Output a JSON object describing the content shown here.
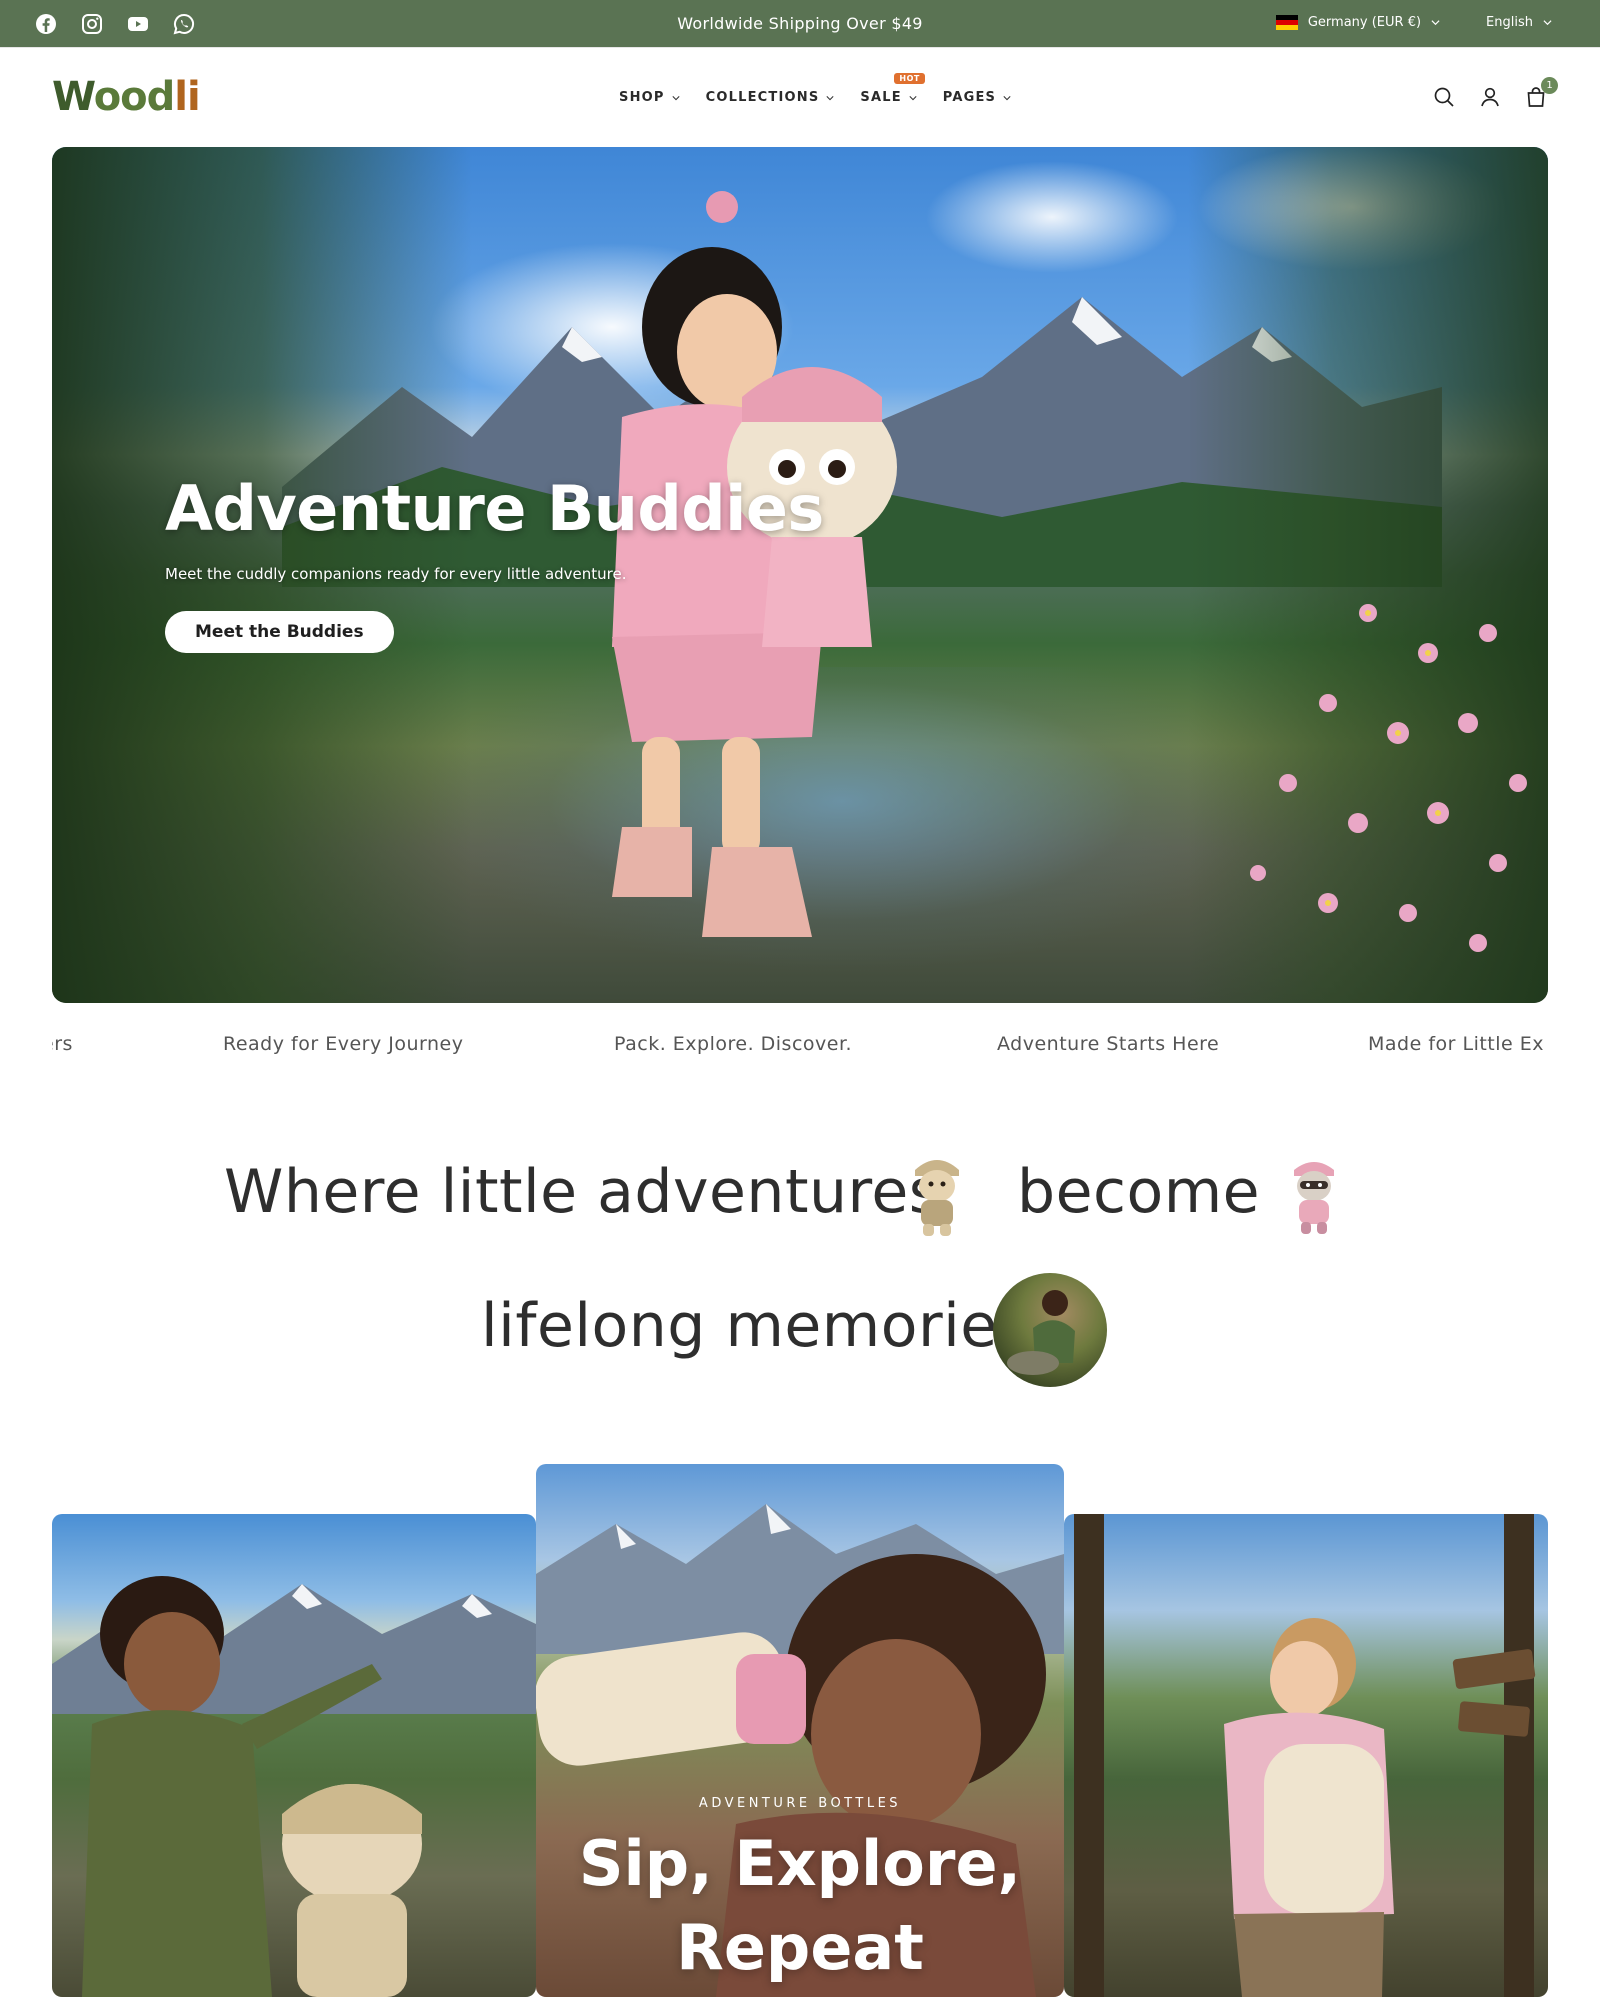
{
  "topbar": {
    "announcement": "Worldwide Shipping Over $49",
    "social": [
      "facebook-icon",
      "instagram-icon",
      "youtube-icon",
      "whatsapp-icon"
    ],
    "currency": "Germany (EUR €)",
    "language": "English"
  },
  "header": {
    "logo": {
      "part1": "W",
      "part2": "ood",
      "part3": "li"
    },
    "nav": [
      {
        "label": "SHOP"
      },
      {
        "label": "COLLECTIONS"
      },
      {
        "label": "SALE",
        "badge": "HOT"
      },
      {
        "label": "PAGES"
      }
    ],
    "cart_count": "1"
  },
  "hero": {
    "title": "Adventure Buddies",
    "subtitle": "Meet the cuddly companions ready for every little adventure.",
    "button": "Meet the Buddies"
  },
  "marquee": {
    "items": [
      "ers",
      "Ready for Every Journey",
      "Pack. Explore. Discover.",
      "Adventure Starts Here",
      "Made for Little Ex"
    ]
  },
  "statement": {
    "line1a": "Where little adventures",
    "line1b": "become",
    "line2": "lifelong memories"
  },
  "cards": {
    "middle": {
      "eyebrow": "ADVENTURE BOTTLES",
      "title_line1": "Sip, Explore,",
      "title_line2": "Repeat"
    }
  },
  "colors": {
    "topbar_bg": "#5a7353",
    "hot_badge": "#e0702f",
    "cart_badge": "#6b8a5a"
  }
}
